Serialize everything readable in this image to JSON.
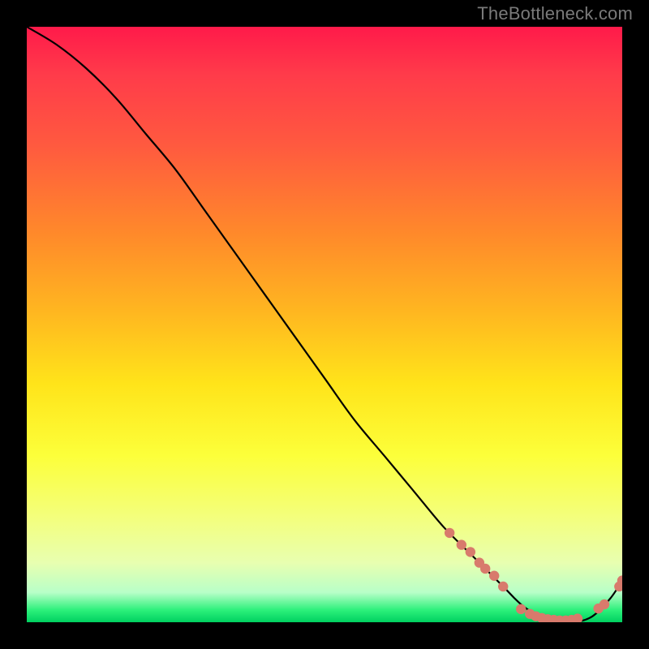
{
  "watermark": "TheBottleneck.com",
  "colors": {
    "dot": "#d87a6c",
    "line": "#000000",
    "frame": "#000000"
  },
  "chart_data": {
    "type": "line",
    "title": "",
    "xlabel": "",
    "ylabel": "",
    "xlim": [
      0,
      100
    ],
    "ylim": [
      0,
      100
    ],
    "grid": false,
    "series": [
      {
        "name": "bottleneck-curve",
        "x": [
          0,
          5,
          10,
          15,
          20,
          25,
          30,
          35,
          40,
          45,
          50,
          55,
          60,
          65,
          70,
          75,
          80,
          83,
          86,
          89,
          92,
          95,
          98,
          100
        ],
        "y": [
          100,
          97,
          93,
          88,
          82,
          76,
          69,
          62,
          55,
          48,
          41,
          34,
          28,
          22,
          16,
          11,
          6,
          3,
          1,
          0,
          0,
          1,
          4,
          7
        ]
      }
    ],
    "markers": {
      "name": "highlighted-dots",
      "x": [
        71,
        73,
        74.5,
        76,
        77,
        78.5,
        80,
        83,
        84.5,
        85.5,
        86.5,
        87.5,
        88.5,
        89.5,
        90.5,
        91.5,
        92.5,
        96,
        97,
        99.5,
        100
      ],
      "y": [
        15,
        13,
        11.8,
        10,
        9,
        7.8,
        6,
        2.2,
        1.4,
        1.0,
        0.7,
        0.5,
        0.4,
        0.3,
        0.3,
        0.4,
        0.6,
        2.3,
        3.0,
        6,
        7
      ]
    }
  }
}
